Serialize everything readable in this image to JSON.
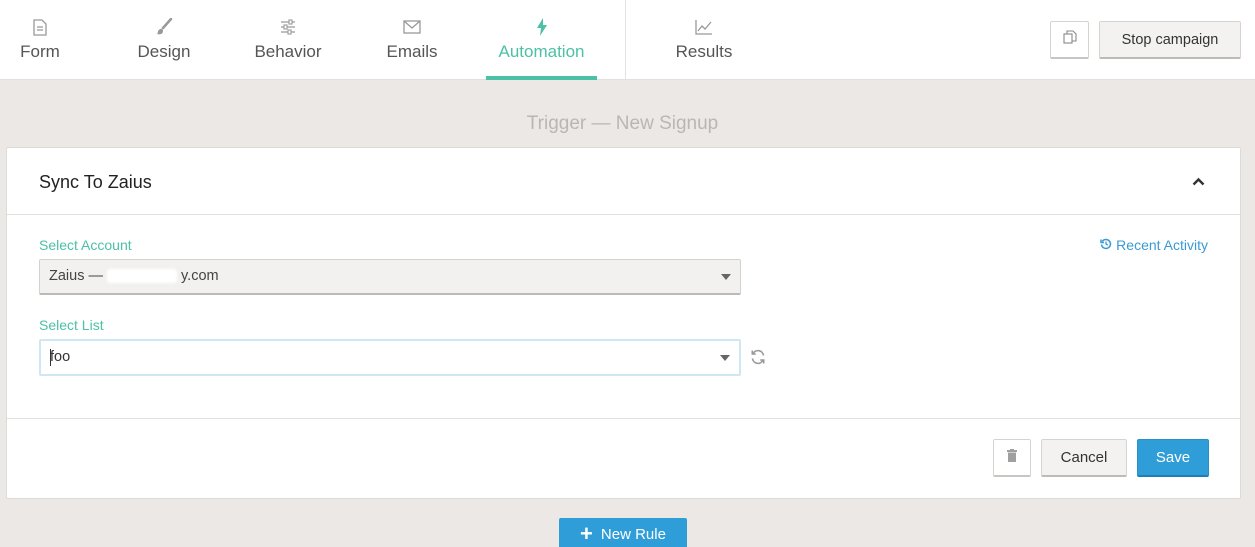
{
  "nav": {
    "tabs": [
      {
        "label": "Form",
        "icon": "document-icon"
      },
      {
        "label": "Design",
        "icon": "brush-icon"
      },
      {
        "label": "Behavior",
        "icon": "sliders-icon"
      },
      {
        "label": "Emails",
        "icon": "envelope-icon"
      },
      {
        "label": "Automation",
        "icon": "lightning-icon",
        "active": true
      },
      {
        "label": "Results",
        "icon": "line-chart-icon"
      }
    ],
    "actions": {
      "copy_icon": "copy-icon",
      "stop_label": "Stop campaign"
    }
  },
  "trigger": {
    "title": "Trigger — New Signup"
  },
  "rule": {
    "title": "Sync To Zaius",
    "recent_activity": "Recent Activity",
    "account": {
      "label": "Select Account",
      "value_prefix": "Zaius —",
      "value_suffix": "y.com"
    },
    "list": {
      "label": "Select List",
      "value": "foo"
    },
    "footer": {
      "cancel_label": "Cancel",
      "save_label": "Save"
    }
  },
  "new_rule_label": "New Rule",
  "colors": {
    "accent": "#4cc1a5",
    "primary": "#2f9ed8",
    "background": "#ebe8e5"
  }
}
